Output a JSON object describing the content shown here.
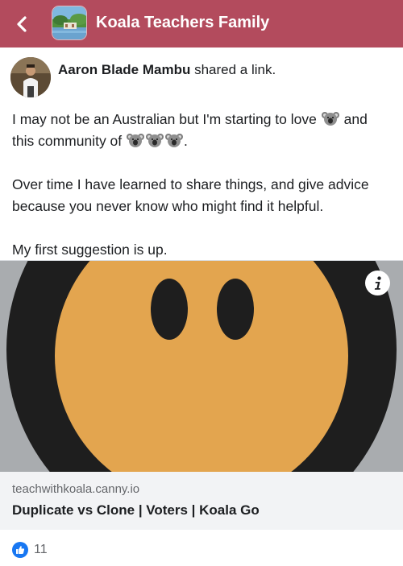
{
  "header": {
    "back_icon": "chevron-left-icon",
    "group_name": "Koala Teachers Family",
    "background": "#b34b5d"
  },
  "post": {
    "author_name": "Aaron Blade Mambu",
    "action_text": "shared a link.",
    "paragraph_1_part_1": "I may not be an Australian but I'm starting to love",
    "paragraph_1_part_2": "and this community of",
    "paragraph_1_end": ".",
    "paragraph_2": "Over time I have learned to share things, and give advice because you never know who might find it helpful.",
    "paragraph_3": "My first suggestion is up.",
    "emoji": "koala-emoji"
  },
  "link_preview": {
    "domain": "teachwithkoala.canny.io",
    "title": "Duplicate vs Clone | Voters | Koala Go",
    "info_icon": "info-icon",
    "image_colors": {
      "face": "#e3a54f",
      "ring": "#1e1e1e",
      "background": "#a9acaf"
    }
  },
  "reactions": {
    "icon": "like-icon",
    "count": "11",
    "accent": "#1877f2"
  }
}
